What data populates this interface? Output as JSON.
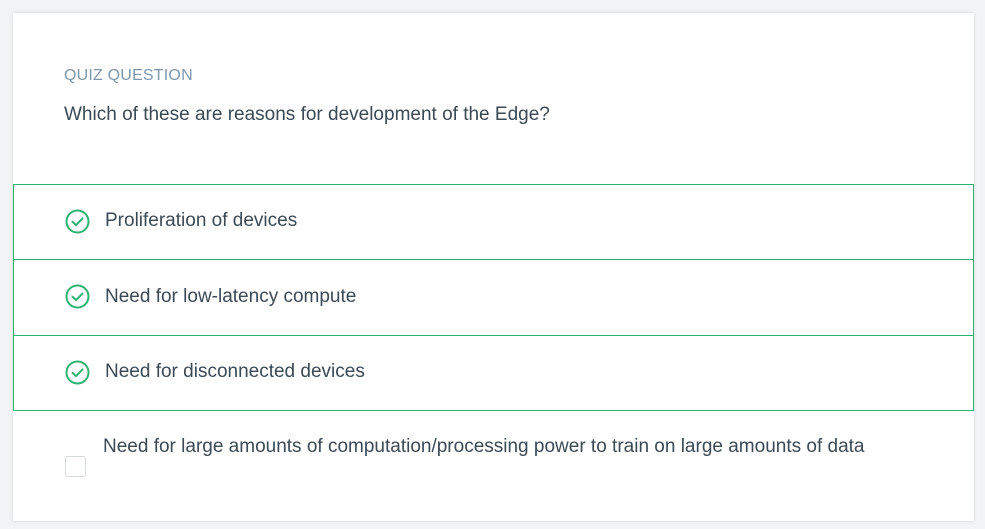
{
  "quiz": {
    "eyebrow": "QUIZ QUESTION",
    "question": "Which of these are reasons for development of the Edge?",
    "options": [
      {
        "label": "Proliferation of devices",
        "selected": true,
        "icon": "check-circle-icon"
      },
      {
        "label": "Need for low-latency compute",
        "selected": true,
        "icon": "check-circle-icon"
      },
      {
        "label": "Need for disconnected devices",
        "selected": true,
        "icon": "check-circle-icon"
      },
      {
        "label": "Need for large amounts of computation/processing power to train on large amounts of data",
        "selected": false,
        "icon": "checkbox-empty-icon"
      }
    ]
  },
  "colors": {
    "accent": "#2db36f",
    "eyebrow": "#7d97ad",
    "text": "#3c4a54",
    "background": "#f2f3f4"
  }
}
